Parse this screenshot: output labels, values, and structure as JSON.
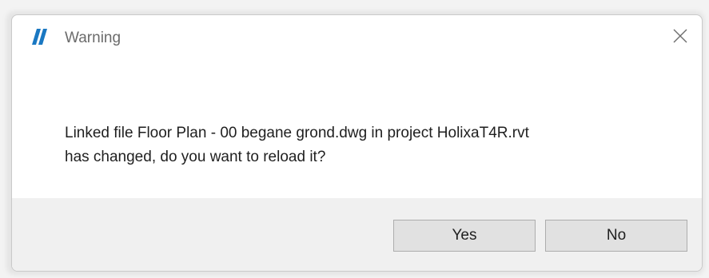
{
  "dialog": {
    "title": "Warning",
    "icon": "app-logo-icon",
    "close_icon": "close-icon",
    "message_line1": "Linked file Floor Plan - 00 begane grond.dwg in project HolixaT4R.rvt",
    "message_line2": "has changed, do you want to reload it?",
    "buttons": {
      "yes_label": "Yes",
      "no_label": "No"
    },
    "colors": {
      "accent": "#1a78c2",
      "footer_bg": "#f0f0f0",
      "button_bg": "#e1e1e1",
      "button_border": "#adadad"
    }
  }
}
